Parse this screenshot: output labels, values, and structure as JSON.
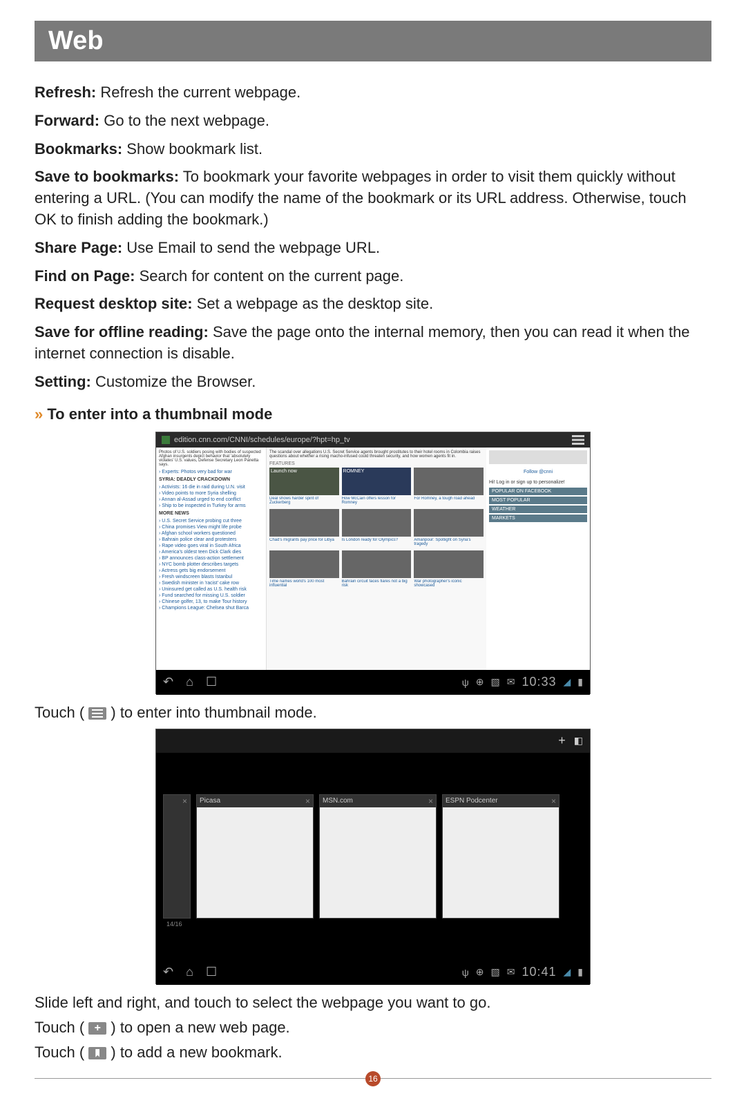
{
  "header": "Web",
  "items": [
    {
      "term": "Refresh:",
      "desc": "Refresh the current webpage."
    },
    {
      "term": "Forward:",
      "desc": "Go to the next webpage."
    },
    {
      "term": "Bookmarks:",
      "desc": "Show bookmark list."
    },
    {
      "term": "Save to bookmarks:",
      "desc": "To bookmark your favorite webpages in order to visit them quickly without entering a URL. (You can modify the name of the bookmark or its URL address. Otherwise, touch OK to finish adding the bookmark.)"
    },
    {
      "term": "Share Page:",
      "desc": "Use Email to send the webpage URL."
    },
    {
      "term": "Find on Page:",
      "desc": "Search for content on the current page."
    },
    {
      "term": "Request desktop site:",
      "desc": "Set a webpage as the desktop site."
    },
    {
      "term": "Save for offline reading:",
      "desc": "Save the page onto the internal memory, then you can read it when the internet connection is disable."
    },
    {
      "term": "Setting:",
      "desc": "Customize the Browser."
    }
  ],
  "subheading": "To enter into a thumbnail mode",
  "screenshot1": {
    "url": "edition.cnn.com/CNNI/schedules/europe/?hpt=hp_tv",
    "left_hd1": "SYRIA: DEADLY CRACKDOWN",
    "left_hd2": "MORE NEWS",
    "left_links": [
      "Activists: 16 die in raid during U.N. visit",
      "Video points to more Syria shelling",
      "Annan al-Assad urged to end conflict",
      "Ship to be inspected in Turkey for arms"
    ],
    "left_links2": [
      "U.S. Secret Service probing cut three",
      "China promises View might life probe",
      "Afghan school workers questioned",
      "Bahrain police clear and protesters",
      "Rape video goes viral in South Africa",
      "America's oldest teen Dick Clark dies",
      "BP announces class-action settlement",
      "NYC bomb plotter describes targets",
      "Actress gets big endorsement",
      "Fresh windscreen blasts Istanbul",
      "Swedish minister in 'racist' cake row",
      "Uninsured get called as U.S. health risk",
      "Fund searched for missing U.S. soldier",
      "Chinese golfer, 13, to make Tour history",
      "Champions League: Chelsea shut Barca"
    ],
    "right_follow": "Follow @cnni",
    "right_login": "Hi! Log in or sign up to personalize!",
    "right_boxes": [
      "POPULAR ON FACEBOOK",
      "MOST POPULAR",
      "WEATHER",
      "MARKETS"
    ],
    "mid_captions": [
      "Deal shows harder spirit of Zuckerberg",
      "How McCain offers lesson for Romney",
      "For Romney, a tough road ahead",
      "Chad's migrants pay price for Libya",
      "Is London ready for Olympics?",
      "Amanpour: Spotlight on Syria's tragedy",
      "Time names world's 100 most influential",
      "Bahrain circuit faces flares not a big risk",
      "War photographer's iconic showcased"
    ],
    "time": "10:33"
  },
  "instr1_pre": "Touch ( ",
  "instr1_post": " ) to enter into thumbnail mode.",
  "screenshot2": {
    "tabs": [
      "Picasa",
      "MSN.com",
      "ESPN Podcenter"
    ],
    "count": "14/16",
    "time": "10:41"
  },
  "instr2": "Slide left and right, and touch to select the webpage you want to go.",
  "instr3_pre": "Touch ( ",
  "instr3_post": " )  to open a new web page.",
  "instr4_pre": "Touch ( ",
  "instr4_post": " ) to add a new bookmark.",
  "page_number": "16"
}
